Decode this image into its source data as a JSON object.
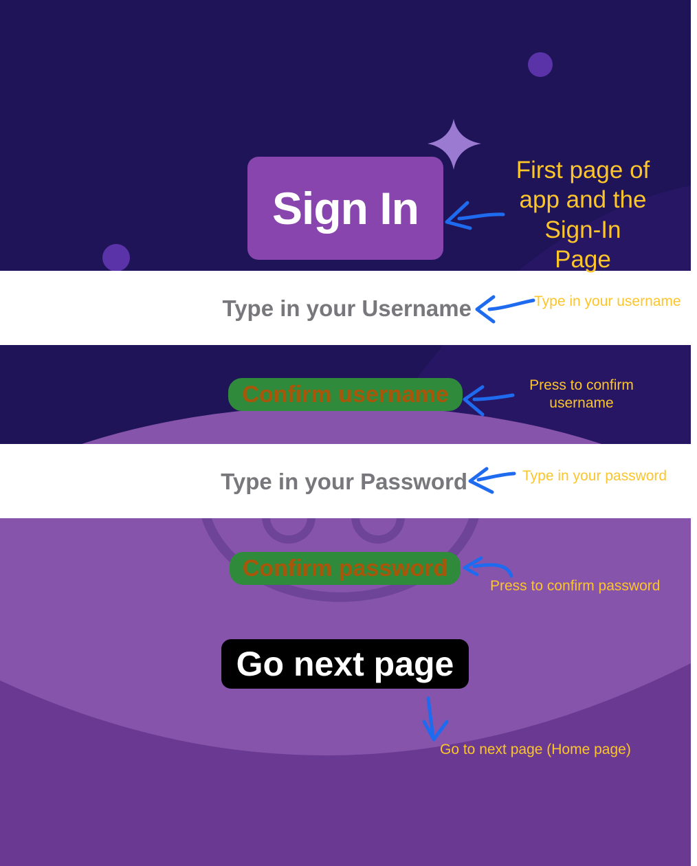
{
  "signin": {
    "button_label": "Sign In"
  },
  "username": {
    "placeholder": "Type in your Username",
    "value": ""
  },
  "confirm_username": {
    "label": "Confirm username"
  },
  "password": {
    "placeholder": "Type in your Password",
    "value": ""
  },
  "confirm_password": {
    "label": "Confirm password"
  },
  "next_page": {
    "label": "Go next page"
  },
  "annotations": {
    "first_page": "First page of app and the Sign-In Page",
    "type_username": "Type in your username",
    "confirm_username": "Press to confirm username",
    "type_password": "Type in your password",
    "confirm_password": "Press to confirm password",
    "next_page": "Go to next page (Home page)"
  },
  "colors": {
    "background_dark": "#1f1458",
    "background_purple": "#8654ab",
    "signin_button": "#8745ad",
    "confirm_button": "#2f8a3b",
    "confirm_text": "#a8560a",
    "annotation_text": "#fcc52b",
    "annotation_arrow": "#1f6bf0"
  },
  "icons": [
    "sparkle-icon",
    "annotation-arrow-icon"
  ]
}
